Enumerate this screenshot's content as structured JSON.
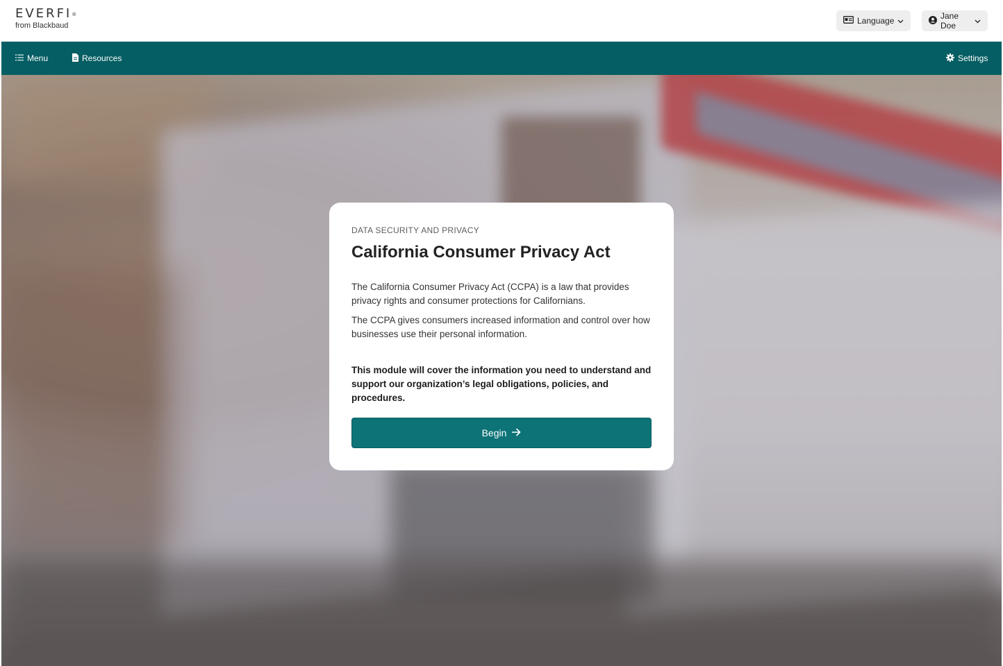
{
  "header": {
    "logo_text": "EVERFI",
    "logo_mark": "®",
    "logo_sub": "from Blackbaud",
    "language_label": "Language",
    "user_label": "Jane Doe"
  },
  "nav": {
    "menu_label": "Menu",
    "resources_label": "Resources",
    "settings_label": "Settings"
  },
  "card": {
    "eyebrow": "DATA SECURITY AND PRIVACY",
    "title": "California Consumer Privacy Act",
    "paragraph1": "The California Consumer Privacy Act (CCPA) is a law that provides privacy rights and consumer protections for Californians.",
    "paragraph2": "The CCPA gives consumers increased information and control over how businesses use their personal information.",
    "paragraph3": "This module will cover the information you need to understand and support our organization’s legal obligations, policies, and procedures.",
    "begin_label": "Begin"
  },
  "colors": {
    "nav_bg": "#055e63",
    "button_bg": "#0d7377"
  },
  "icons": [
    "id-card-icon",
    "chevron-down-icon",
    "user-circle-icon",
    "list-icon",
    "document-icon",
    "gear-icon",
    "arrow-right-icon"
  ]
}
